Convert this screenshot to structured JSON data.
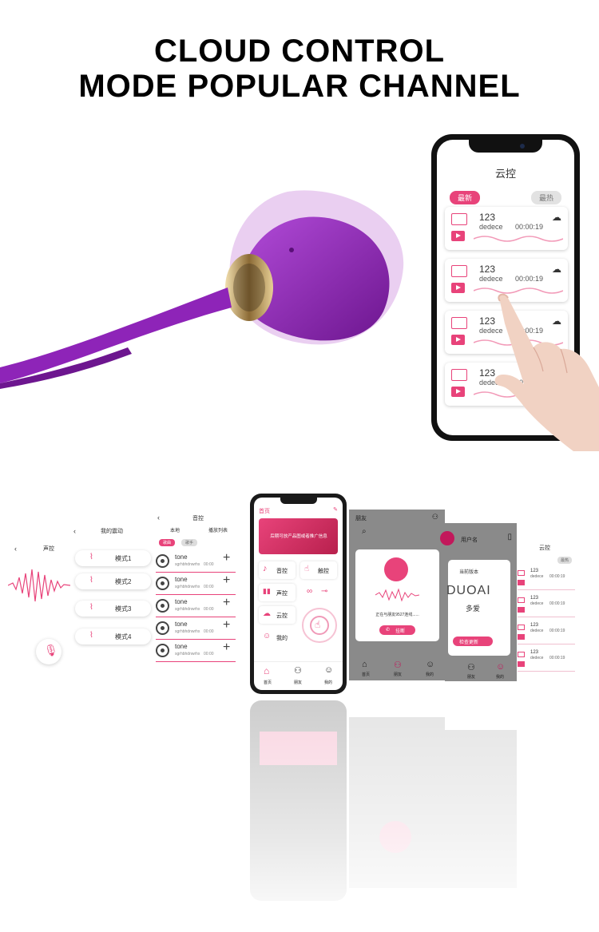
{
  "headline": {
    "line1": "CLOUD CONTROL",
    "line2": "MODE POPULAR CHANNEL"
  },
  "big_phone": {
    "title": "云控",
    "tab_new": "最新",
    "tab_hot": "最热",
    "records": [
      {
        "name": "123",
        "user": "dedece",
        "time": "00:00:19"
      },
      {
        "name": "123",
        "user": "dedece",
        "time": "00:00:19"
      },
      {
        "name": "123",
        "user": "dedece",
        "time": "00:00:19"
      },
      {
        "name": "123",
        "user": "dedece",
        "time": "00:00:19"
      }
    ]
  },
  "screen_voice": {
    "title": "声控"
  },
  "screen_vibe": {
    "title": "我的震动",
    "modes": [
      "模式1",
      "模式2",
      "模式3",
      "模式4"
    ]
  },
  "screen_music": {
    "title": "音控",
    "tab_local": "本地",
    "tab_playlist": "播放列表",
    "chip_a": "歌曲",
    "chip_b": "歌手",
    "tracks": [
      {
        "name": "tone",
        "sub": "sgrhbhdnwrhx",
        "time": "00:00"
      },
      {
        "name": "tone",
        "sub": "sgrhbhdnwrhx",
        "time": "00:00"
      },
      {
        "name": "tone",
        "sub": "sgrhbhdnwrhx",
        "time": "00:00"
      },
      {
        "name": "tone",
        "sub": "sgrhbhdnwrhx",
        "time": "00:00"
      },
      {
        "name": "tone",
        "sub": "sgrhbhdnwrhx",
        "time": "00:00"
      }
    ]
  },
  "screen_home": {
    "title": "首页",
    "banner": "后期可放产品图或者推广信息",
    "menu": [
      "音控",
      "触控",
      "声控",
      "云控",
      "我的"
    ],
    "nav": [
      "首页",
      "朋友",
      "我的"
    ]
  },
  "screen_friends": {
    "title": "朋友",
    "connecting": "正在与朋友9527连线......",
    "hangup": "挂断",
    "nav": [
      "首页",
      "朋友",
      "我的"
    ]
  },
  "screen_user": {
    "title": "用户名",
    "version_label": "当前版本",
    "brand": "DUOAI",
    "brand_cn": "多爱",
    "update": "检查更新",
    "nav": [
      "首页",
      "朋友",
      "我的"
    ]
  },
  "screen_cloud_small": {
    "title": "云控",
    "tab_hot": "最热",
    "records": [
      {
        "name": "123",
        "user": "dedece",
        "time": "00:00:19"
      },
      {
        "name": "123",
        "user": "dedece",
        "time": "00:00:19"
      },
      {
        "name": "123",
        "user": "dedece",
        "time": "00:00:19"
      },
      {
        "name": "123",
        "user": "dedece",
        "time": "00:00:19"
      }
    ]
  },
  "colors": {
    "accent": "#e8437a",
    "product": "#8e24b8",
    "gold": "#c9a45c"
  }
}
